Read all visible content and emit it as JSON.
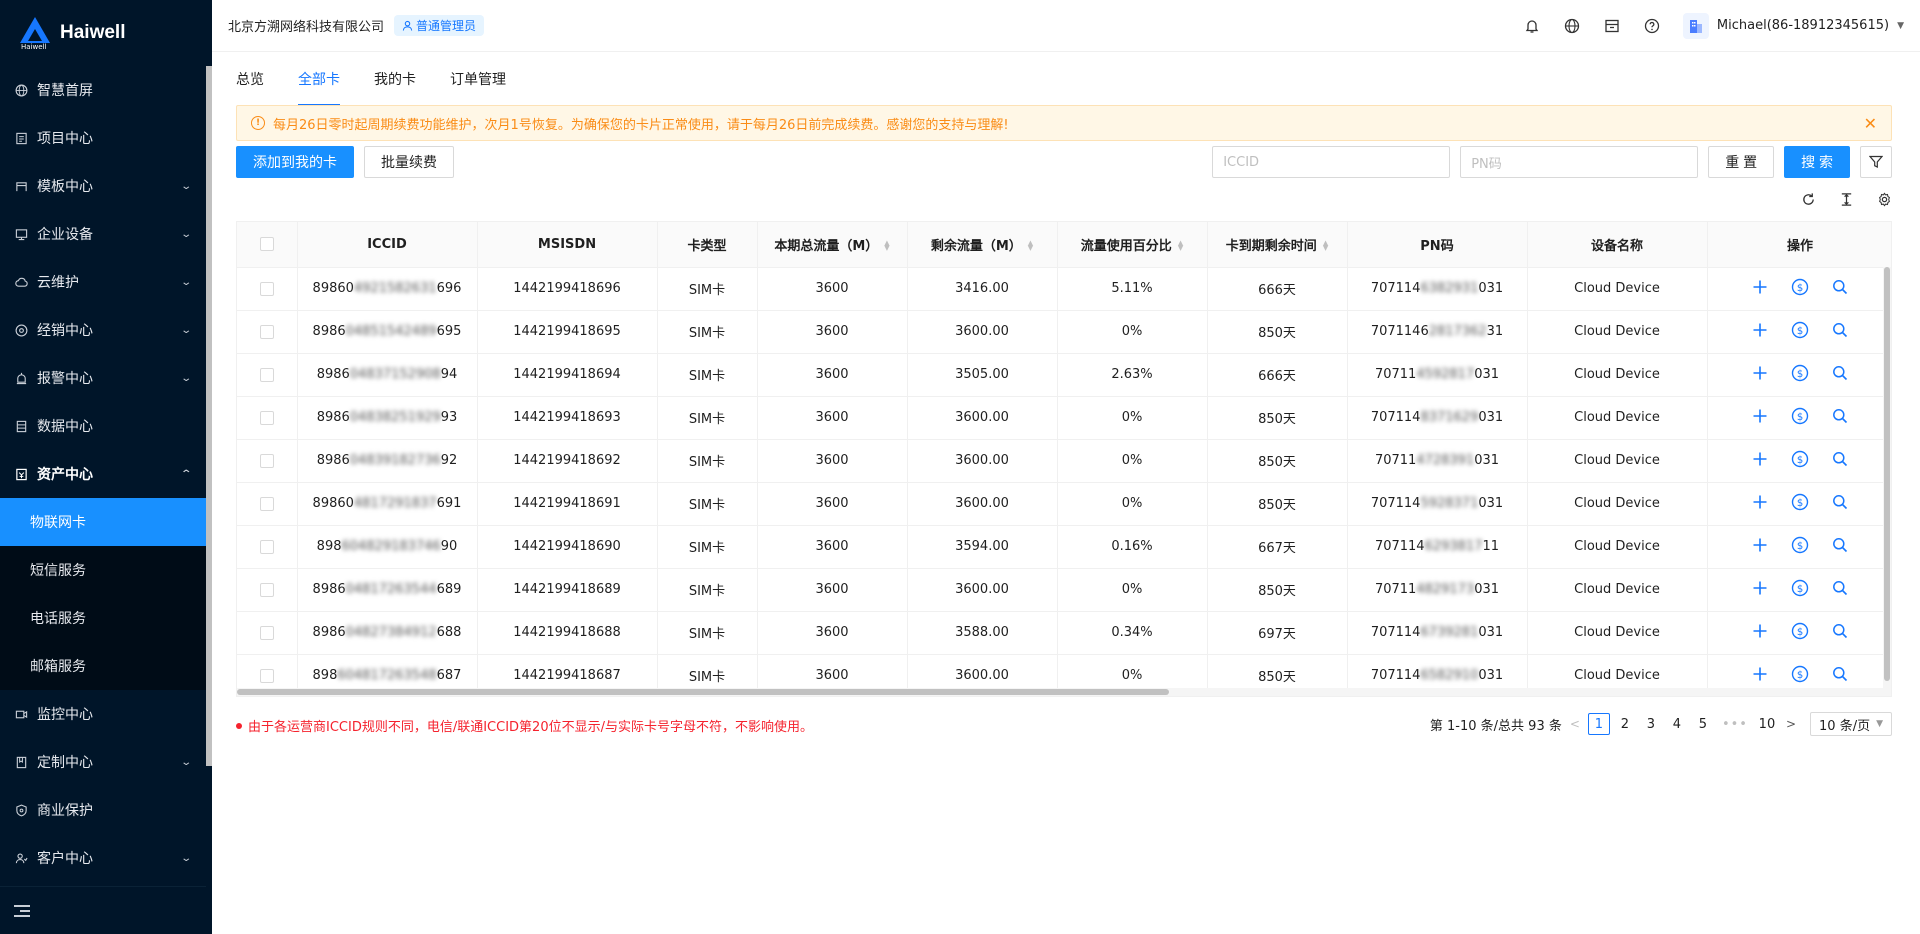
{
  "brand": {
    "name": "Haiwell",
    "logo_sub": "Haiwell"
  },
  "sidebar": {
    "items": [
      {
        "label": "智慧首屏",
        "icon": "globe-icon",
        "has_children": false
      },
      {
        "label": "项目中心",
        "icon": "document-icon",
        "has_children": false
      },
      {
        "label": "模板中心",
        "icon": "template-icon",
        "has_children": true
      },
      {
        "label": "企业设备",
        "icon": "monitor-icon",
        "has_children": true
      },
      {
        "label": "云维护",
        "icon": "cloud-icon",
        "has_children": true
      },
      {
        "label": "经销中心",
        "icon": "dealer-icon",
        "has_children": true
      },
      {
        "label": "报警中心",
        "icon": "alarm-icon",
        "has_children": true
      },
      {
        "label": "数据中心",
        "icon": "database-icon",
        "has_children": false
      },
      {
        "label": "资产中心",
        "icon": "asset-icon",
        "has_children": true,
        "open": true
      }
    ],
    "asset_sub": [
      {
        "label": "物联网卡",
        "active": true
      },
      {
        "label": "短信服务",
        "active": false
      },
      {
        "label": "电话服务",
        "active": false
      },
      {
        "label": "邮箱服务",
        "active": false
      }
    ],
    "items_after": [
      {
        "label": "监控中心",
        "icon": "camera-icon",
        "has_children": false
      },
      {
        "label": "定制中心",
        "icon": "custom-icon",
        "has_children": true
      },
      {
        "label": "商业保护",
        "icon": "shield-icon",
        "has_children": false
      },
      {
        "label": "客户中心",
        "icon": "users-icon",
        "has_children": true
      }
    ]
  },
  "header": {
    "company": "北京方溯网络科技有限公司",
    "role": "普通管理员",
    "user": "Michael(86-18912345615)"
  },
  "tabs": [
    {
      "label": "总览",
      "active": false
    },
    {
      "label": "全部卡",
      "active": true
    },
    {
      "label": "我的卡",
      "active": false
    },
    {
      "label": "订单管理",
      "active": false
    }
  ],
  "notice": {
    "text": "每月26日零时起周期续费功能维护，次月1号恢复。为确保您的卡片正常使用，请于每月26日前完成续费。感谢您的支持与理解!"
  },
  "toolbar": {
    "add_label": "添加到我的卡",
    "renew_label": "批量续费",
    "iccid_placeholder": "ICCID",
    "pn_placeholder": "PN码",
    "reset_label": "重 置",
    "search_label": "搜 索"
  },
  "table": {
    "columns": [
      "ICCID",
      "MSISDN",
      "卡类型",
      "本期总流量（M）",
      "剩余流量（M）",
      "流量使用百分比",
      "卡到期剩余时间",
      "PN码",
      "设备名称",
      "操作"
    ],
    "rows": [
      {
        "iccid_a": "89860",
        "iccid_m": "4921582631",
        "iccid_b": "696",
        "msisdn": "1442199418696",
        "type": "SIM卡",
        "total": "3600",
        "remain": "3416.00",
        "pct": "5.11%",
        "days": "666天",
        "pn_a": "707114",
        "pn_m": "6382931",
        "pn_b": "031",
        "device": "Cloud Device"
      },
      {
        "iccid_a": "8986",
        "iccid_m": "04851542489",
        "iccid_b": "695",
        "msisdn": "1442199418695",
        "type": "SIM卡",
        "total": "3600",
        "remain": "3600.00",
        "pct": "0%",
        "days": "850天",
        "pn_a": "7071146",
        "pn_m": "2817362",
        "pn_b": "31",
        "device": "Cloud Device"
      },
      {
        "iccid_a": "8986",
        "iccid_m": "04837152908",
        "iccid_b": "94",
        "msisdn": "1442199418694",
        "type": "SIM卡",
        "total": "3600",
        "remain": "3505.00",
        "pct": "2.63%",
        "days": "666天",
        "pn_a": "70711",
        "pn_m": "4592817",
        "pn_b": "031",
        "device": "Cloud Device"
      },
      {
        "iccid_a": "8986",
        "iccid_m": "04838251929",
        "iccid_b": "93",
        "msisdn": "1442199418693",
        "type": "SIM卡",
        "total": "3600",
        "remain": "3600.00",
        "pct": "0%",
        "days": "850天",
        "pn_a": "707114",
        "pn_m": "8371629",
        "pn_b": "031",
        "device": "Cloud Device"
      },
      {
        "iccid_a": "8986",
        "iccid_m": "04839182736",
        "iccid_b": "92",
        "msisdn": "1442199418692",
        "type": "SIM卡",
        "total": "3600",
        "remain": "3600.00",
        "pct": "0%",
        "days": "850天",
        "pn_a": "70711",
        "pn_m": "4728391",
        "pn_b": "031",
        "device": "Cloud Device"
      },
      {
        "iccid_a": "89860",
        "iccid_m": "4817291837",
        "iccid_b": "691",
        "msisdn": "1442199418691",
        "type": "SIM卡",
        "total": "3600",
        "remain": "3600.00",
        "pct": "0%",
        "days": "850天",
        "pn_a": "707114",
        "pn_m": "5928371",
        "pn_b": "031",
        "device": "Cloud Device"
      },
      {
        "iccid_a": "898",
        "iccid_m": "604829183746",
        "iccid_b": "90",
        "msisdn": "1442199418690",
        "type": "SIM卡",
        "total": "3600",
        "remain": "3594.00",
        "pct": "0.16%",
        "days": "667天",
        "pn_a": "707114",
        "pn_m": "6293817",
        "pn_b": "11",
        "device": "Cloud Device"
      },
      {
        "iccid_a": "8986",
        "iccid_m": "04817263544",
        "iccid_b": "689",
        "msisdn": "1442199418689",
        "type": "SIM卡",
        "total": "3600",
        "remain": "3600.00",
        "pct": "0%",
        "days": "850天",
        "pn_a": "70711",
        "pn_m": "4829173",
        "pn_b": "031",
        "device": "Cloud Device"
      },
      {
        "iccid_a": "8986",
        "iccid_m": "04827384912",
        "iccid_b": "688",
        "msisdn": "1442199418688",
        "type": "SIM卡",
        "total": "3600",
        "remain": "3588.00",
        "pct": "0.34%",
        "days": "697天",
        "pn_a": "707114",
        "pn_m": "6739281",
        "pn_b": "031",
        "device": "Cloud Device"
      },
      {
        "iccid_a": "898",
        "iccid_m": "604817263548",
        "iccid_b": "687",
        "msisdn": "1442199418687",
        "type": "SIM卡",
        "total": "3600",
        "remain": "3600.00",
        "pct": "0%",
        "days": "850天",
        "pn_a": "707114",
        "pn_m": "6582910",
        "pn_b": "031",
        "device": "Cloud Device"
      }
    ]
  },
  "footer": {
    "note": "由于各运营商ICCID规则不同，电信/联通ICCID第20位不显示/与实际卡号字母不符，不影响使用。",
    "range_text": "第 1-10 条/总共 93 条",
    "pages": [
      "1",
      "2",
      "3",
      "4",
      "5"
    ],
    "dots": "•••",
    "last_page": "10",
    "page_size": "10 条/页"
  }
}
